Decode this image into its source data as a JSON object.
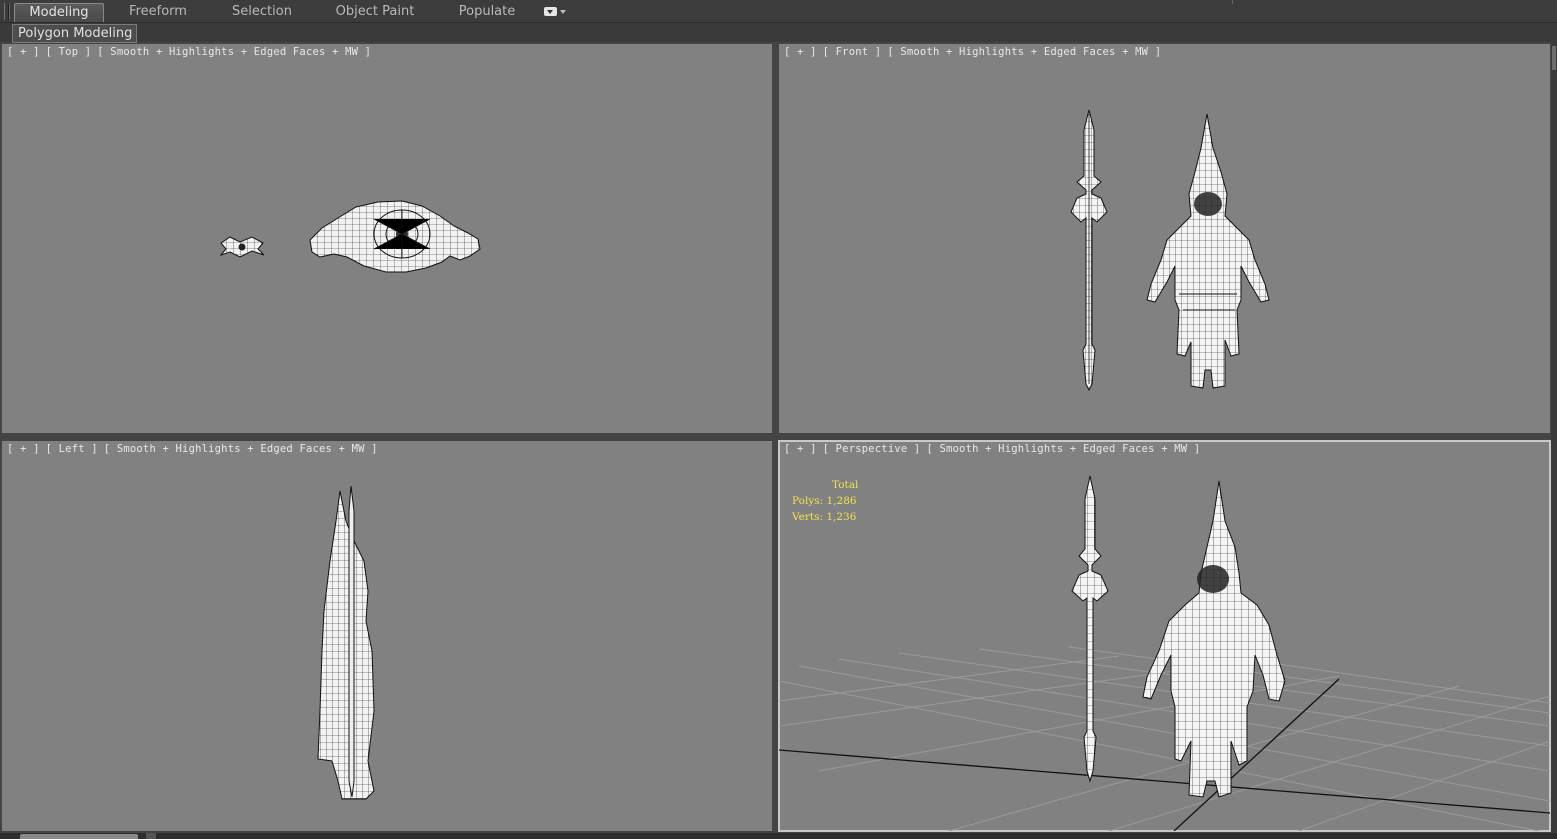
{
  "ribbon": {
    "tabs": [
      {
        "label": "Modeling",
        "active": true
      },
      {
        "label": "Freeform",
        "active": false
      },
      {
        "label": "Selection",
        "active": false
      },
      {
        "label": "Object Paint",
        "active": false
      },
      {
        "label": "Populate",
        "active": false
      }
    ],
    "dropdown_icon": "ribbon-options-icon"
  },
  "subbar": {
    "panel_label": "Polygon Modeling"
  },
  "viewports": {
    "top": {
      "plus": "[ + ]",
      "name": "[ Top ]",
      "shading": "[ Smooth + Highlights + Edged Faces + MW ]"
    },
    "front": {
      "plus": "[ + ]",
      "name": "[ Front ]",
      "shading": "[ Smooth + Highlights + Edged Faces + MW ]"
    },
    "left": {
      "plus": "[ + ]",
      "name": "[ Left ]",
      "shading": "[ Smooth + Highlights + Edged Faces + MW ]"
    },
    "perspective": {
      "plus": "[ + ]",
      "name": "[ Perspective ]",
      "shading": "[ Smooth + Highlights + Edged Faces + MW ]",
      "stats": {
        "title": "Total",
        "polys": "Polys: 1,286",
        "verts": "Verts: 1,236"
      }
    }
  },
  "colors": {
    "viewport_bg": "#818181",
    "ui_bg": "#444444",
    "stats_text": "#f0e24a",
    "active_outline": "#c8c8c8"
  }
}
